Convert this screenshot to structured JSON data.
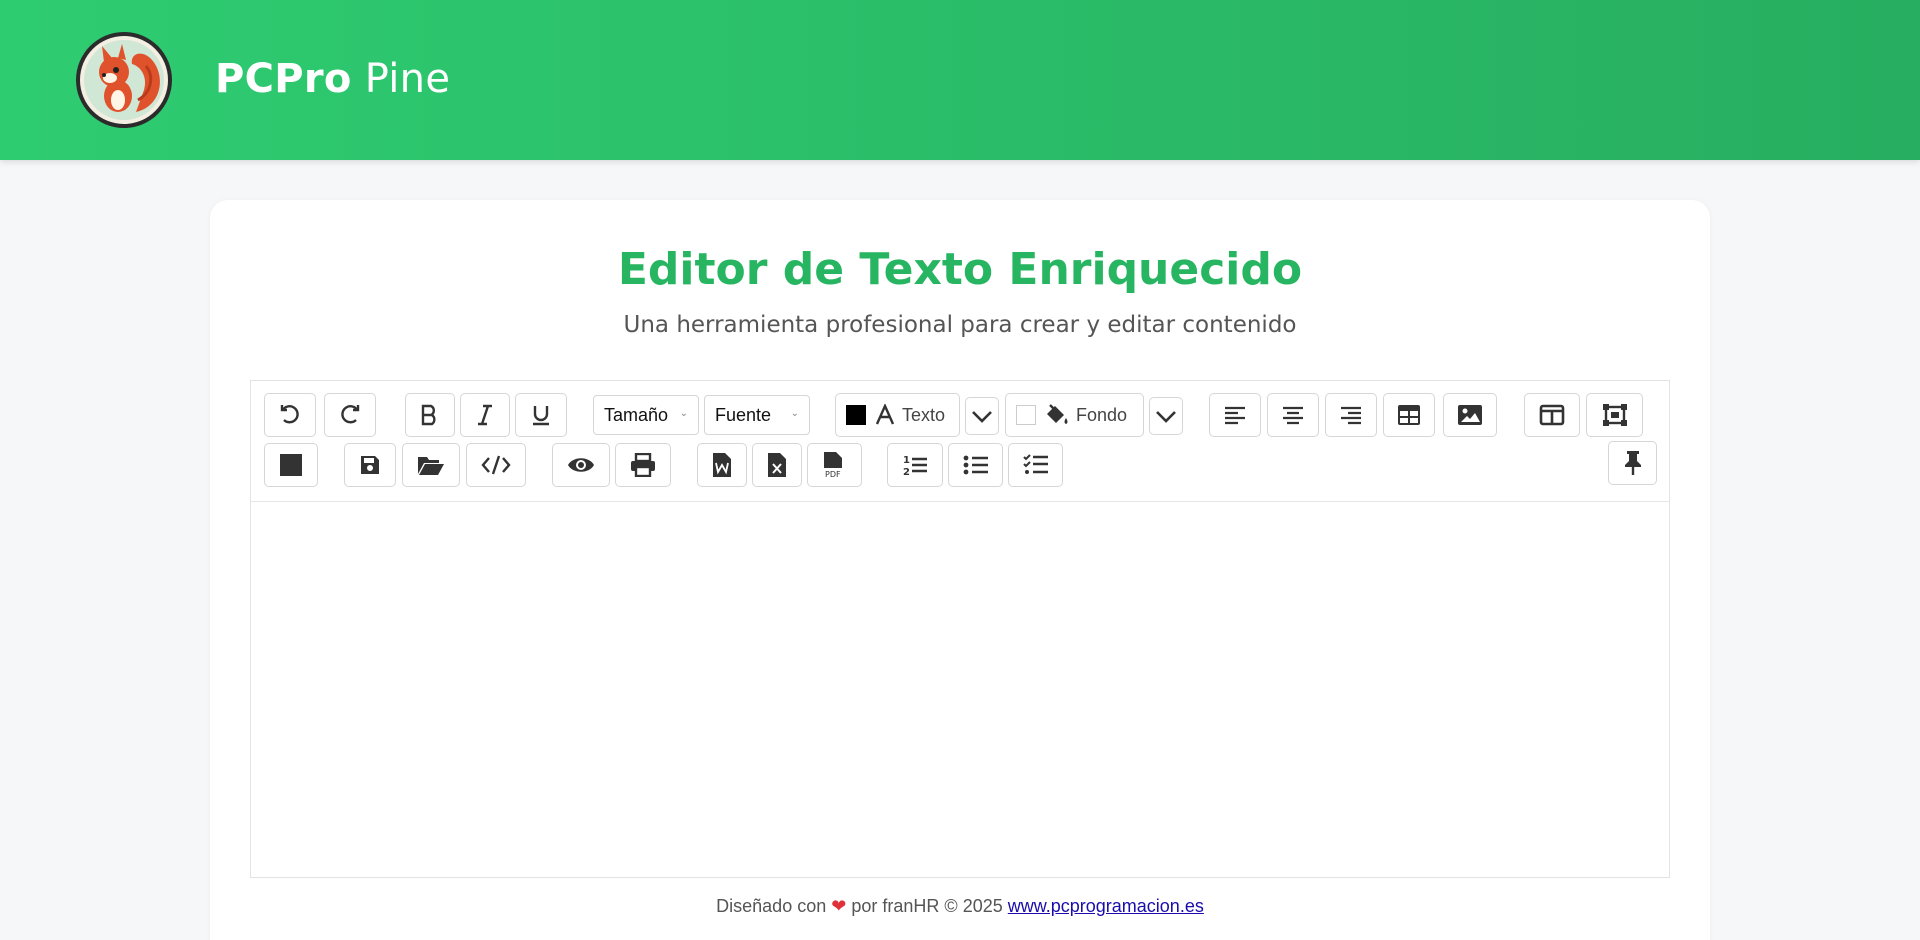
{
  "header": {
    "brand_bold": "PCPro",
    "brand_light": "Pine",
    "logo_icon": "squirrel-logo",
    "colors": {
      "accent": "#2ecc71",
      "accent_dark": "#27ae60",
      "title": "#27b561"
    }
  },
  "main": {
    "title": "Editor de Texto Enriquecido",
    "subtitle": "Una herramienta profesional para crear y editar contenido"
  },
  "toolbar": {
    "size_select": "Tamaño",
    "font_select": "Fuente",
    "text_color_label": "Texto",
    "text_color_value": "#000000",
    "bg_color_label": "Fondo",
    "bg_color_value": "#ffffff",
    "icons": [
      "undo-icon",
      "redo-icon",
      "bold-icon",
      "italic-icon",
      "underline-icon",
      "font-color-icon",
      "paint-bucket-icon",
      "chevron-down-icon",
      "align-left-icon",
      "align-center-icon",
      "align-right-icon",
      "table-icon",
      "image-icon",
      "columns-icon",
      "fullscreen-icon",
      "square-icon",
      "save-icon",
      "folder-open-icon",
      "code-icon",
      "eye-icon",
      "print-icon",
      "word-file-icon",
      "excel-file-icon",
      "pdf-file-icon",
      "ordered-list-icon",
      "unordered-list-icon",
      "checklist-icon",
      "pin-icon"
    ]
  },
  "footer": {
    "prefix": "Diseñado con",
    "middle": "por franHR",
    "copyright": "©",
    "year": "2025",
    "link": "www.pcprogramacion.es"
  }
}
